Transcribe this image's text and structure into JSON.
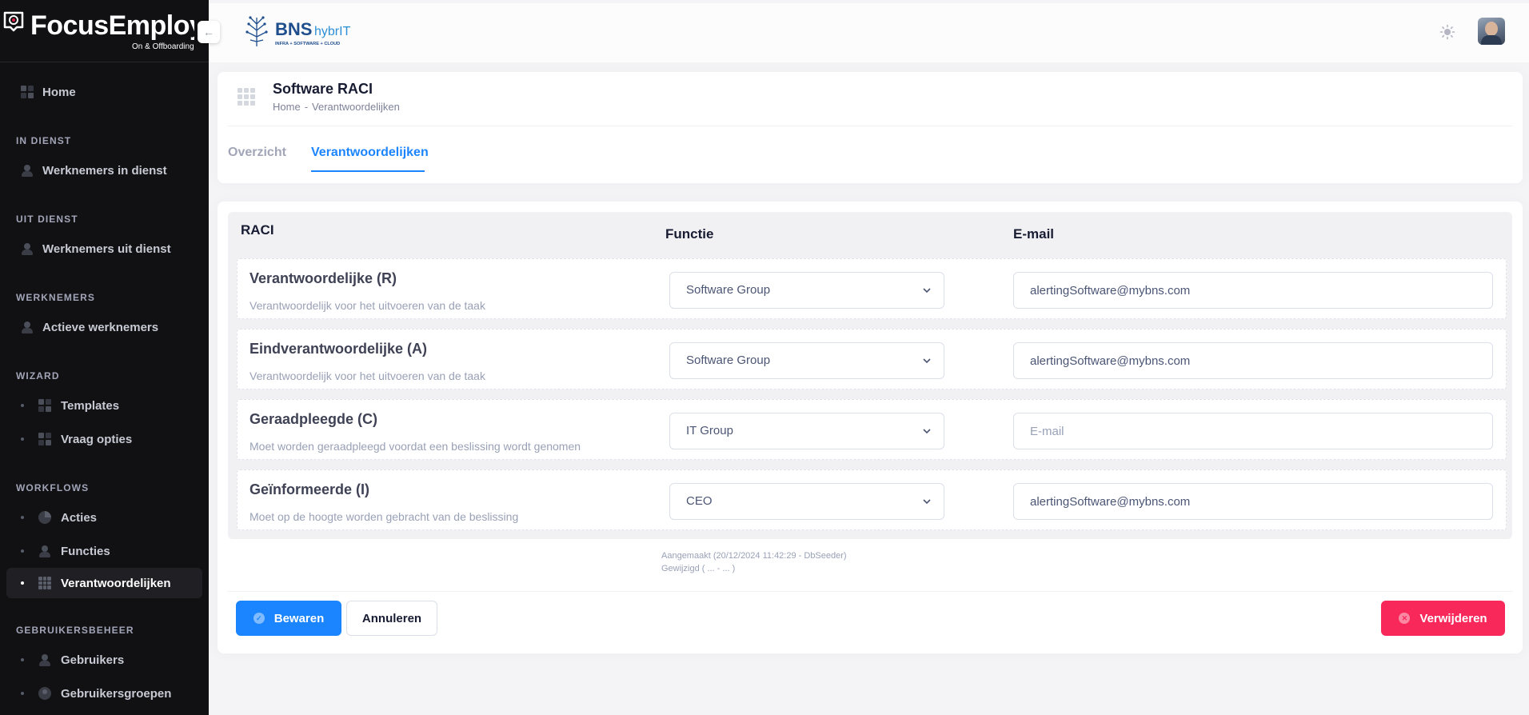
{
  "sidebar": {
    "brand_name": "FocusEmploy",
    "brand_sub": "On & Offboarding",
    "collapse_icon": "arrow-left-icon",
    "home_label": "Home",
    "sections": [
      {
        "heading": "IN DIENST",
        "items": [
          {
            "label": "Werknemers in dienst",
            "icon": "users-icon"
          }
        ]
      },
      {
        "heading": "UIT DIENST",
        "items": [
          {
            "label": "Werknemers uit dienst",
            "icon": "users-icon"
          }
        ]
      },
      {
        "heading": "WERKNEMERS",
        "items": [
          {
            "label": "Actieve werknemers",
            "icon": "users-icon"
          }
        ]
      },
      {
        "heading": "WIZARD",
        "items": [
          {
            "label": "Templates",
            "icon": "grid-icon"
          },
          {
            "label": "Vraag opties",
            "icon": "list-icon"
          }
        ]
      },
      {
        "heading": "WORKFLOWS",
        "items": [
          {
            "label": "Acties",
            "icon": "pie-icon"
          },
          {
            "label": "Functies",
            "icon": "user-icon"
          },
          {
            "label": "Verantwoordelijken",
            "icon": "dots-grid-icon",
            "active": true
          }
        ]
      },
      {
        "heading": "GEBRUIKERSBEHEER",
        "items": [
          {
            "label": "Gebruikers",
            "icon": "users-icon"
          },
          {
            "label": "Gebruikersgroepen",
            "icon": "user-circle-icon"
          }
        ]
      }
    ]
  },
  "header": {
    "company_logo_text": "BNS",
    "company_logo_text2": "hybrIT",
    "company_logo_tagline": "INFRA + SOFTWARE + CLOUD",
    "theme_icon": "sun-icon"
  },
  "page": {
    "title": "Software RACI",
    "breadcrumb": [
      "Home",
      "Verantwoordelijken"
    ],
    "tabs": [
      {
        "label": "Overzicht",
        "active": false
      },
      {
        "label": "Verantwoordelijken",
        "active": true
      }
    ]
  },
  "raci": {
    "headers": {
      "raci": "RACI",
      "functie": "Functie",
      "email": "E-mail"
    },
    "rows": [
      {
        "title": "Verantwoordelijke (R)",
        "description": "Verantwoordelijk voor het uitvoeren van de taak",
        "functie": "Software Group",
        "email": "alertingSoftware@mybns.com",
        "email_placeholder": "E-mail"
      },
      {
        "title": "Eindverantwoordelijke (A)",
        "description": "Verantwoordelijk voor het uitvoeren van de taak",
        "functie": "Software Group",
        "email": "alertingSoftware@mybns.com",
        "email_placeholder": "E-mail"
      },
      {
        "title": "Geraadpleegde (C)",
        "description": "Moet worden geraadpleegd voordat een beslissing wordt genomen",
        "functie": "IT Group",
        "email": "",
        "email_placeholder": "E-mail"
      },
      {
        "title": "Geïnformeerde (I)",
        "description": "Moet op de hoogte worden gebracht van de beslissing",
        "functie": "CEO",
        "email": "alertingSoftware@mybns.com",
        "email_placeholder": "E-mail"
      }
    ]
  },
  "meta": {
    "created": "Aangemaakt (20/12/2024 11:42:29 - DbSeeder)",
    "modified": "Gewijzigd ( ... - ... )"
  },
  "actions": {
    "save": "Bewaren",
    "cancel": "Annuleren",
    "delete": "Verwijderen"
  },
  "colors": {
    "primary": "#1b84ff",
    "danger": "#f8285a",
    "sidebar_bg": "#111114"
  }
}
